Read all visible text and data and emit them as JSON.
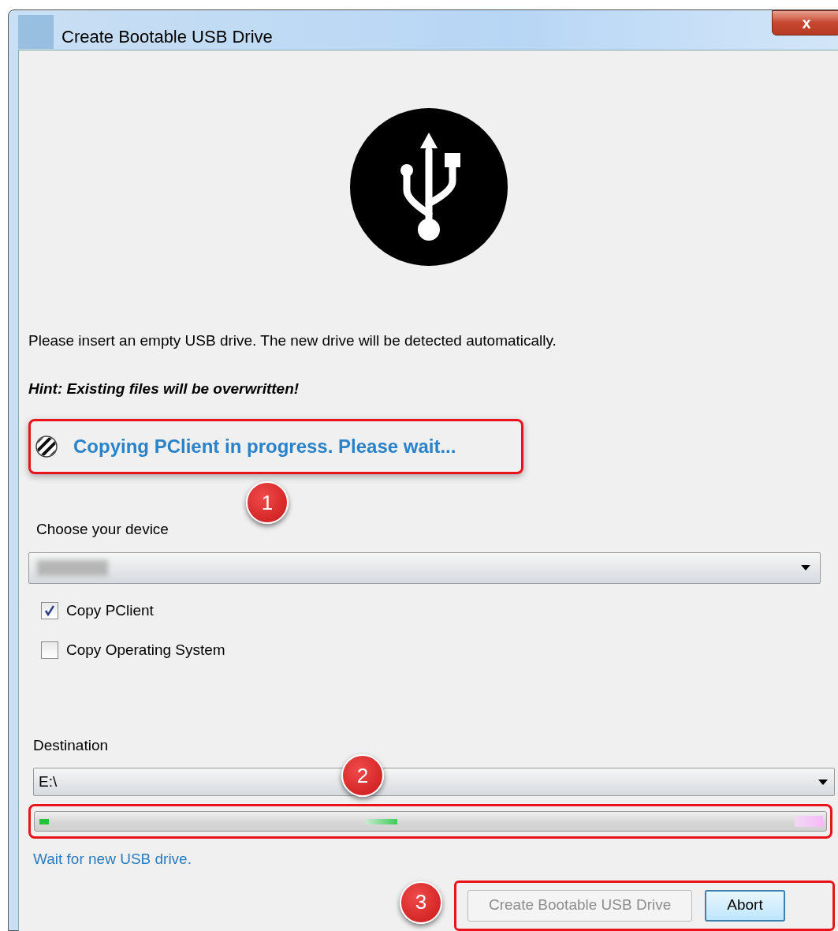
{
  "window": {
    "title": "Create Bootable USB Drive",
    "close_label": "x"
  },
  "instruction": "Please insert an empty USB drive. The new drive will be detected automatically.",
  "hint": "Hint: Existing files will be overwritten!",
  "status": {
    "text": "Copying PClient in progress. Please wait...",
    "marker": "1"
  },
  "device": {
    "label": "Choose your device"
  },
  "options": [
    {
      "label": "Copy PClient",
      "checked": true
    },
    {
      "label": "Copy Operating System",
      "checked": false
    }
  ],
  "destination": {
    "label": "Destination",
    "value": "E:\\",
    "marker": "2"
  },
  "progress": {
    "indeterminate": true
  },
  "progress_message": "Wait for new USB drive.",
  "buttons": {
    "marker": "3",
    "items": [
      {
        "label": "Create Bootable USB Drive",
        "disabled": true
      },
      {
        "label": "Abort",
        "disabled": false
      }
    ]
  }
}
